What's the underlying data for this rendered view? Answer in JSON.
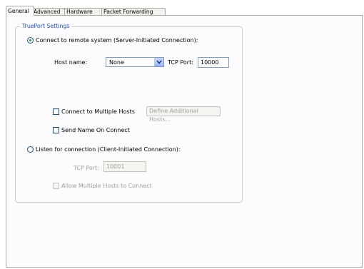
{
  "tabs": [
    "General",
    "Advanced",
    "Hardware",
    "Packet Forwarding"
  ],
  "group_title": "TruePort Settings",
  "server_initiated": {
    "label": "Connect to remote system (Server-Initiated Connection):",
    "selected": true,
    "host_name_label": "Host name:",
    "host_name_value": "None",
    "tcp_port_label": "TCP Port:",
    "tcp_port_value": "10000",
    "multiple_hosts_label": "Connect to Multiple Hosts",
    "multiple_hosts_checked": false,
    "define_hosts_button": "Define Additional Hosts...",
    "send_name_label": "Send Name On Connect",
    "send_name_checked": false
  },
  "client_initiated": {
    "label": "Listen for connection (Client-Initiated Connection):",
    "selected": false,
    "tcp_port_label": "TCP Port:",
    "tcp_port_value": "10001",
    "allow_multiple_label": "Allow Multiple Hosts to Connect",
    "allow_multiple_checked": false
  },
  "colors": {
    "accent": "#1e4bb8",
    "radio_dot": "#2a9a2a"
  },
  "icons": {
    "dropdown": "chevron-down-icon"
  }
}
